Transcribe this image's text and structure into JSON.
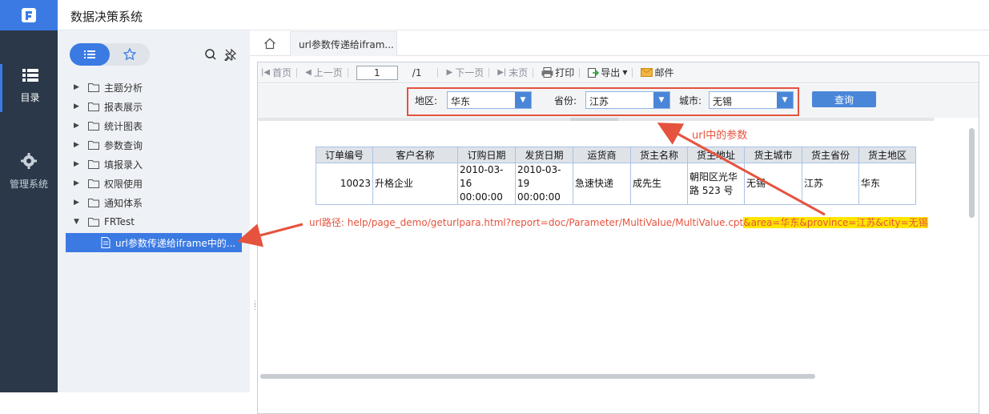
{
  "header": {
    "app_title": "数据决策系统"
  },
  "rail": {
    "items": [
      {
        "label": "目录",
        "icon": "list-icon"
      },
      {
        "label": "管理系统",
        "icon": "gear-icon"
      }
    ]
  },
  "directory": {
    "tree": [
      {
        "label": "主题分析"
      },
      {
        "label": "报表展示"
      },
      {
        "label": "统计图表"
      },
      {
        "label": "参数查询"
      },
      {
        "label": "填报录入"
      },
      {
        "label": "权限使用"
      },
      {
        "label": "通知体系"
      },
      {
        "label": "FRTest"
      }
    ],
    "leaf_label": "url参数传递给iframe中的..."
  },
  "tabs": {
    "report_tab": "url参数传递给ifram..."
  },
  "toolbar": {
    "first": "首页",
    "prev": "上一页",
    "page_value": "1",
    "page_total": "/1",
    "next": "下一页",
    "last": "末页",
    "print": "打印",
    "export": "导出",
    "mail": "邮件"
  },
  "params": {
    "area_label": "地区:",
    "area_value": "华东",
    "province_label": "省份:",
    "province_value": "江苏",
    "city_label": "城市:",
    "city_value": "无锡",
    "query": "查询"
  },
  "table": {
    "headers": [
      "订单编号",
      "客户名称",
      "订购日期",
      "发货日期",
      "运货商",
      "货主名称",
      "货主地址",
      "货主城市",
      "货主省份",
      "货主地区"
    ],
    "row": [
      "10023",
      "升格企业",
      "2010-03-16 00:00:00",
      "2010-03-19 00:00:00",
      "急速快递",
      "成先生",
      "朝阳区光华路 523 号",
      "无锡",
      "江苏",
      "华东"
    ]
  },
  "annotations": {
    "url_note": "url中的参数",
    "url_prefix": "url路径: help/page_demo/geturlpara.html?report=doc/Parameter/MultiValue/MultiValue.cpt",
    "url_params": "&area=华东&province=江苏&city=无锡"
  },
  "colors": {
    "accent": "#3b7ae3",
    "rail": "#2a3849",
    "annotation": "#e5533e",
    "highlight": "#ffe600"
  }
}
